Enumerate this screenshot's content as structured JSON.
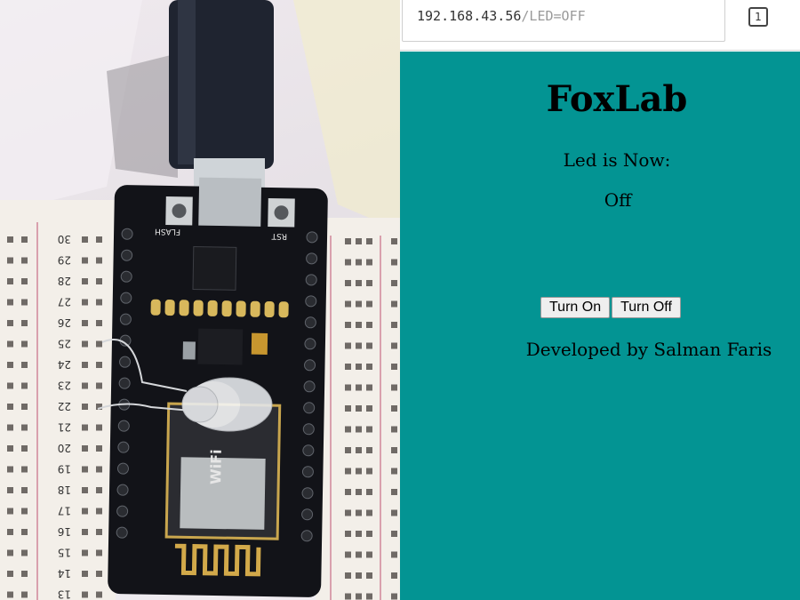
{
  "browser": {
    "url_host": "192.168.43.56",
    "url_path": "/LED=OFF",
    "tab_count": "1"
  },
  "page": {
    "title": "FoxLab",
    "status_label": "Led is Now:",
    "status_value": "Off",
    "turn_on_label": "Turn On",
    "turn_off_label": "Turn Off",
    "credit": "Developed by Salman Faris",
    "background_color": "#039493"
  },
  "photo": {
    "breadboard_numbers": [
      "30",
      "29",
      "28",
      "27",
      "26",
      "25",
      "24",
      "23",
      "22",
      "21",
      "20",
      "19",
      "18",
      "17",
      "16",
      "15",
      "14",
      "13"
    ],
    "board_labels": {
      "flash": "FLASH",
      "rst": "RST",
      "wifi": "WiFi"
    }
  }
}
